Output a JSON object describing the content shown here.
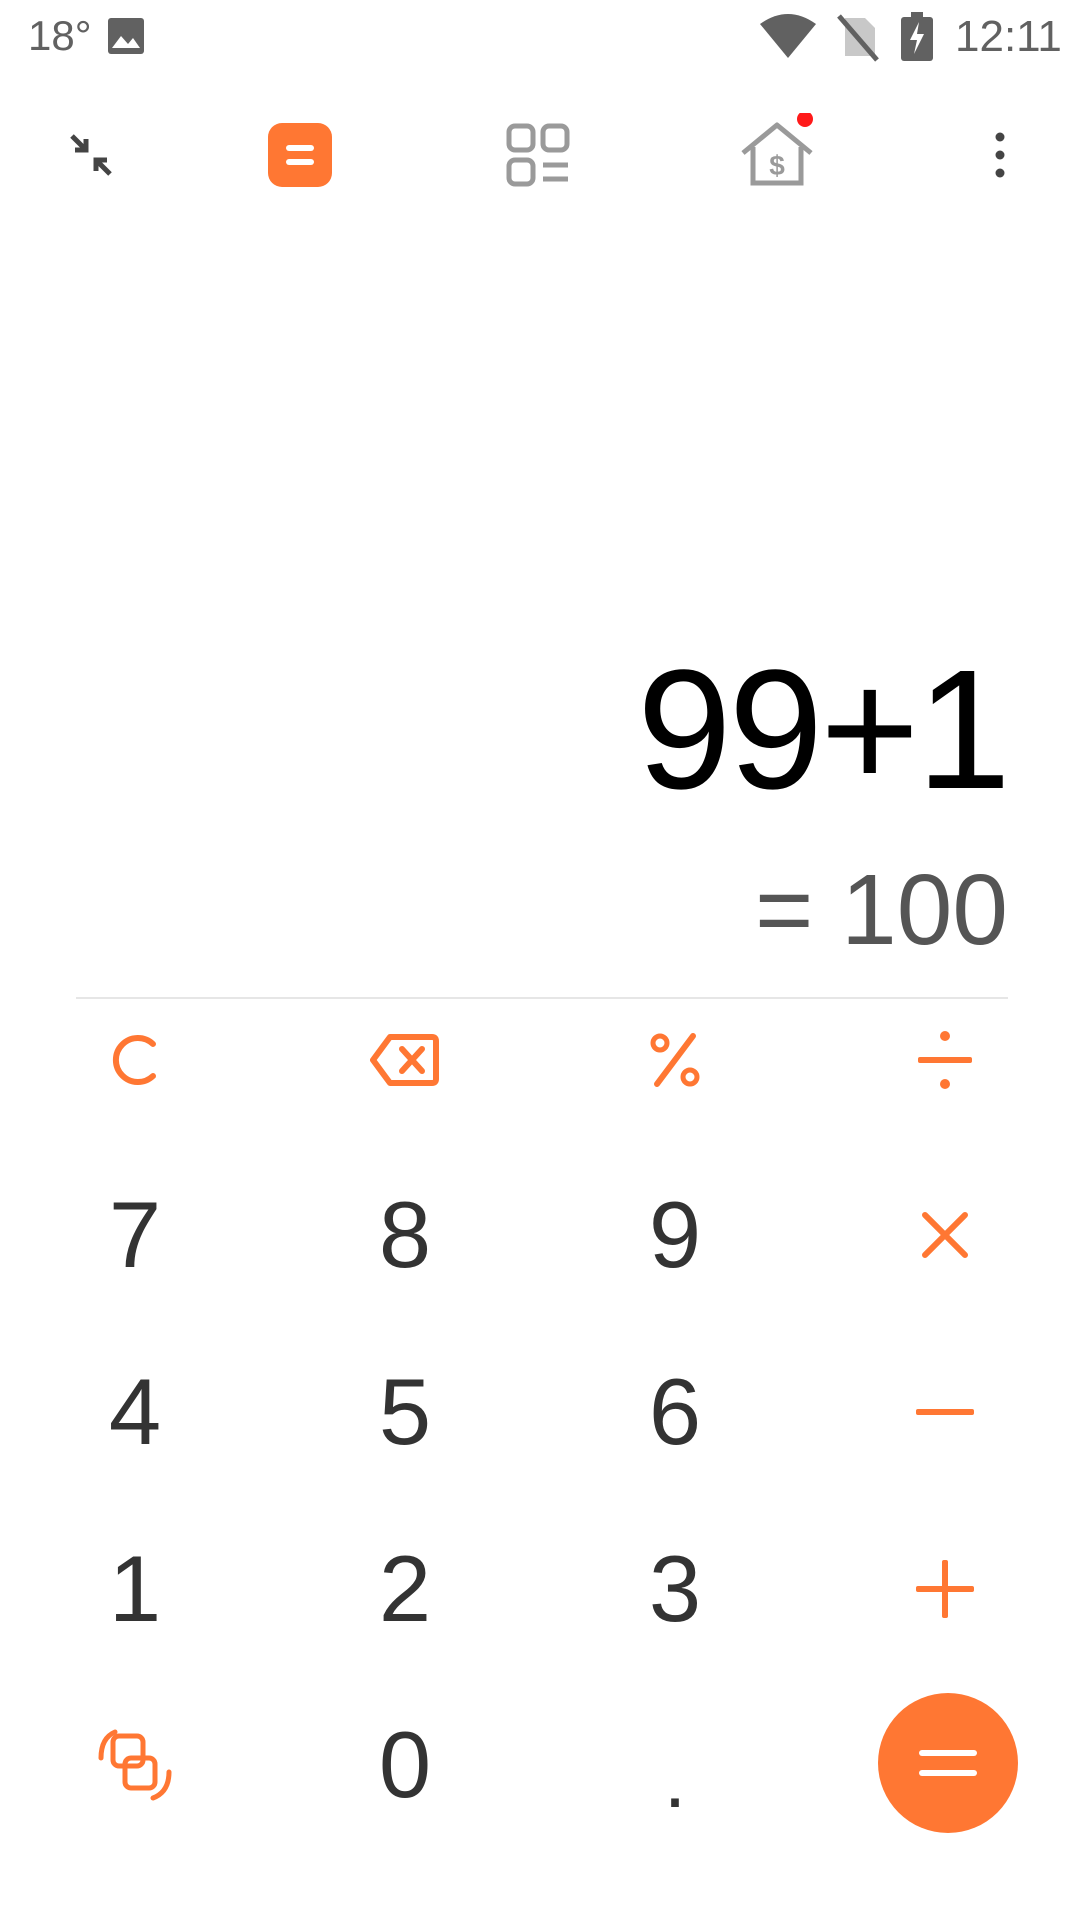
{
  "status_bar": {
    "temperature": "18°",
    "time": "12:11",
    "icons": [
      "gallery-icon",
      "wifi-icon",
      "no-sim-icon",
      "battery-charging-icon"
    ]
  },
  "toolbar": {
    "icons": [
      "collapse-icon",
      "calculator-mode-icon",
      "converter-grid-icon",
      "mortgage-house-icon",
      "more-vert-icon"
    ],
    "active": "calculator-mode-icon",
    "notification_dot_color": "#ff1a1a"
  },
  "display": {
    "expression": "99+1",
    "result": "= 100"
  },
  "keypad": {
    "row1": [
      "C",
      "⌫",
      "%",
      "÷"
    ],
    "row2": [
      "7",
      "8",
      "9",
      "×"
    ],
    "row3": [
      "4",
      "5",
      "6",
      "−"
    ],
    "row4": [
      "1",
      "2",
      "3",
      "+"
    ],
    "row5": [
      "switch-icon",
      "0",
      ".",
      "="
    ]
  },
  "colors": {
    "accent": "#ff7733",
    "digit": "#333333",
    "expression": "#000000",
    "result": "#555555"
  }
}
